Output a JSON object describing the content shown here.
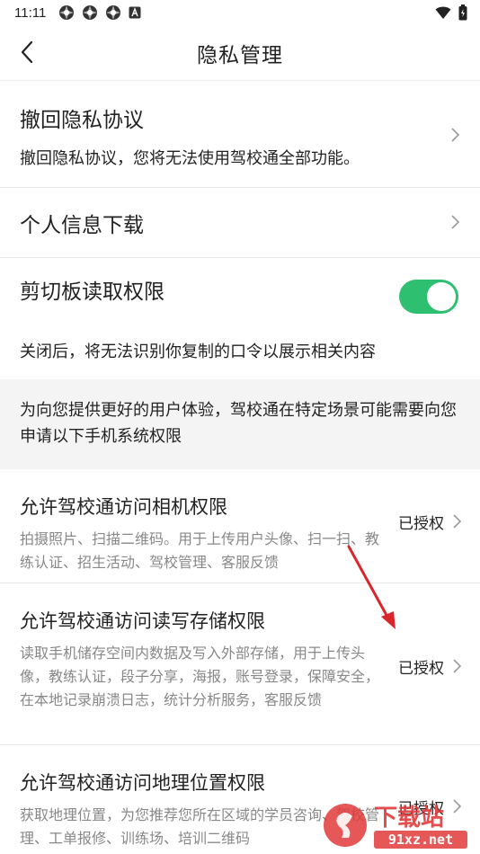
{
  "status_bar": {
    "time": "11:11",
    "notification_icons": [
      "app-notification-icon",
      "app-notification-icon",
      "app-notification-icon",
      "a-icon"
    ],
    "right_icons": [
      "wifi-icon",
      "battery-icon"
    ]
  },
  "nav": {
    "title": "隐私管理",
    "back_icon": "chevron-left-icon"
  },
  "revoke": {
    "title": "撤回隐私协议",
    "desc": "撤回隐私协议，您将无法使用驾校通全部功能。"
  },
  "download": {
    "title": "个人信息下载"
  },
  "clipboard": {
    "title": "剪切板读取权限",
    "toggle_on": true,
    "toggle_color": "#2fbf71",
    "desc": "关闭后，将无法识别你复制的口令以展示相关内容"
  },
  "info": {
    "text": "为向您提供更好的用户体验，驾校通在特定场景可能需要向您申请以下手机系统权限"
  },
  "permissions": [
    {
      "title": "允许驾校通访问相机权限",
      "desc": "拍摄照片、扫描二维码。用于上传用户头像、扫一扫、教练认证、招生活动、驾校管理、客服反馈",
      "status": "已授权"
    },
    {
      "title": "允许驾校通访问读写存储权限",
      "desc": "读取手机储存空间内数据及写入外部存储，用于上传头像，教练认证，段子分享，海报，账号登录，保障安全，在本地记录崩溃日志，统计分析服务，客服反馈",
      "status": "已授权"
    },
    {
      "title": "允许驾校通访问地理位置权限",
      "desc": "获取地理位置，为您推荐您所在区域的学员咨询、驾校管理、工单报修、训练场、培训二维码",
      "status": "已授权"
    }
  ],
  "annotation": {
    "arrow_color": "#d9262c"
  },
  "watermark": {
    "text": "下载站",
    "url_text": "91xz.net"
  }
}
